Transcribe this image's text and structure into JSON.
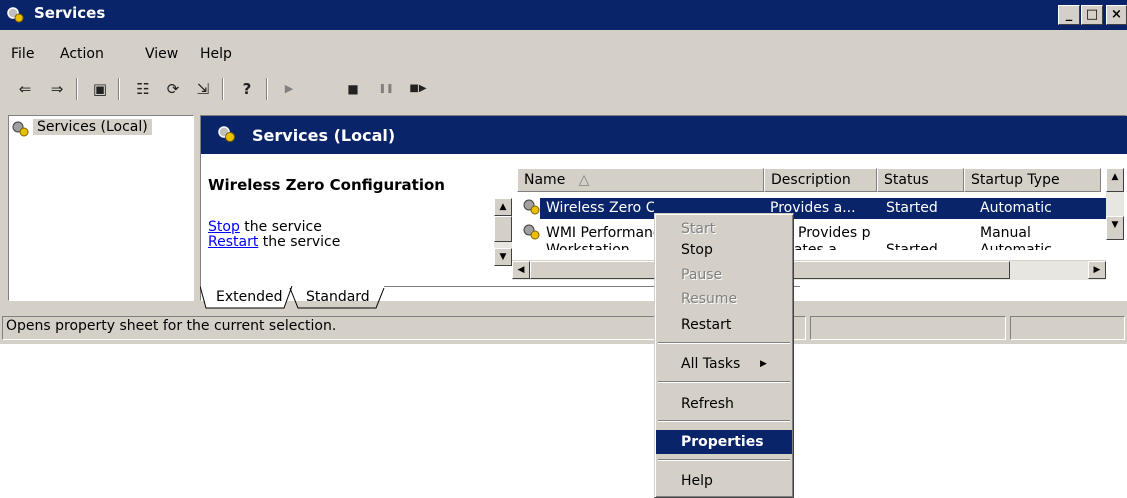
{
  "window": {
    "title": "Services",
    "controls": [
      "_",
      "□",
      "×"
    ]
  },
  "menubar": [
    "File",
    "Action",
    "View",
    "Help"
  ],
  "toolbar": {
    "buttons": [
      {
        "icon": "back-arrow-icon",
        "glyph": "⇐"
      },
      {
        "icon": "forward-arrow-icon",
        "glyph": "⇒"
      },
      {
        "icon": "show-hide-console-tree-icon",
        "glyph": "▣"
      },
      {
        "icon": "properties-icon",
        "glyph": "☷"
      },
      {
        "icon": "refresh-icon",
        "glyph": "⟳"
      },
      {
        "icon": "export-list-icon",
        "glyph": "⇲"
      },
      {
        "icon": "help-icon",
        "glyph": "?"
      },
      {
        "icon": "start-service-icon",
        "glyph": "▶"
      },
      {
        "icon": "stop-service-icon",
        "glyph": "■"
      },
      {
        "icon": "pause-service-icon",
        "glyph": "❚❚"
      },
      {
        "icon": "restart-service-icon",
        "glyph": "■▶"
      }
    ]
  },
  "tree": {
    "root_label": "Services (Local)"
  },
  "pane": {
    "banner_title": "Services (Local)",
    "selected_service": "Wireless Zero Configuration",
    "stop_link": "Stop",
    "stop_rest": " the service",
    "restart_link": "Restart",
    "restart_rest": " the service"
  },
  "list": {
    "columns": [
      "Name",
      "Description",
      "Status",
      "Startup Type"
    ],
    "sort_indicator": "△",
    "rows": [
      {
        "name": "Wireless Zero Configuration",
        "description": "Provides a...",
        "status": "Started",
        "startup": "Automatic"
      },
      {
        "name": "WMI Performance Adapter",
        "description": "Provides p...",
        "status": "",
        "startup": "Manual"
      },
      {
        "name": "Workstation",
        "description": "Creates a...",
        "status": "Started",
        "startup": "Automatic"
      }
    ]
  },
  "tabs": [
    "Extended",
    "Standard"
  ],
  "status_bar": {
    "text": "Opens property sheet for the current selection."
  },
  "context_menu": {
    "items": [
      {
        "label": "Start",
        "enabled": false
      },
      {
        "label": "Stop",
        "enabled": true
      },
      {
        "label": "Pause",
        "enabled": false
      },
      {
        "label": "Resume",
        "enabled": false
      },
      {
        "label": "Restart",
        "enabled": true
      },
      {
        "label": "All Tasks",
        "enabled": true,
        "submenu_glyph": "▶"
      },
      {
        "label": "Refresh",
        "enabled": true
      },
      {
        "label": "Properties",
        "enabled": true,
        "highlighted": true
      },
      {
        "label": "Help",
        "enabled": true
      }
    ]
  },
  "colors": {
    "title_bar": "#0a246a",
    "face": "#d4d0c8",
    "selection": "#0a246a",
    "link": "#0000ff"
  }
}
